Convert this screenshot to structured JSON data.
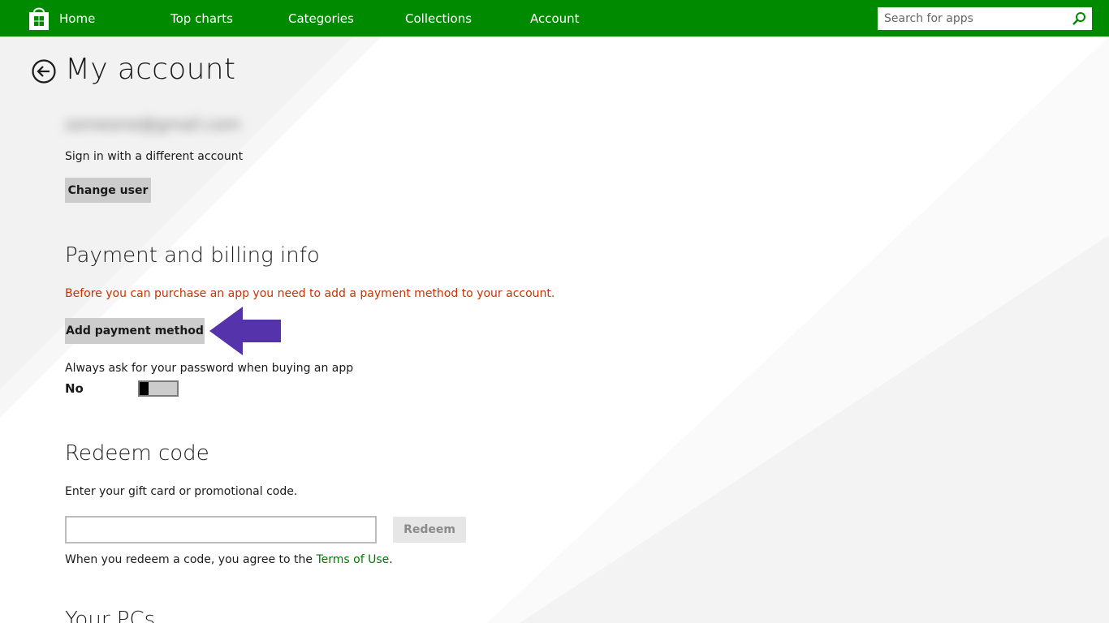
{
  "nav": {
    "home": "Home",
    "top_charts": "Top charts",
    "categories": "Categories",
    "collections": "Collections",
    "account": "Account",
    "search_placeholder": "Search for apps"
  },
  "page": {
    "title": "My account",
    "email": "someone@gmail.com",
    "sign_in_different": "Sign in with a different account",
    "change_user_button": "Change user"
  },
  "payment": {
    "title": "Payment and billing info",
    "warning": "Before you can purchase an app you need to add a payment method to your account.",
    "add_payment_button": "Add payment method",
    "password_prompt_label": "Always ask for your password when buying an app",
    "password_toggle_value": "No",
    "password_toggle_on": false
  },
  "redeem": {
    "title": "Redeem code",
    "instructions": "Enter your gift card or promotional code.",
    "code_value": "",
    "redeem_button": "Redeem",
    "agree_prefix": "When you redeem a code, you agree to the",
    "terms_link": "Terms of Use",
    "agree_suffix": "."
  },
  "pcs": {
    "title": "Your PCs"
  },
  "colors": {
    "topbar": "#008a00",
    "warning": "#c63400",
    "link": "#007a00",
    "arrow": "#5533aa"
  },
  "icons": {
    "logo": "store-bag-icon",
    "back": "back-arrow-circle-icon",
    "search": "search-icon",
    "annotation": "pointer-arrow-icon"
  }
}
